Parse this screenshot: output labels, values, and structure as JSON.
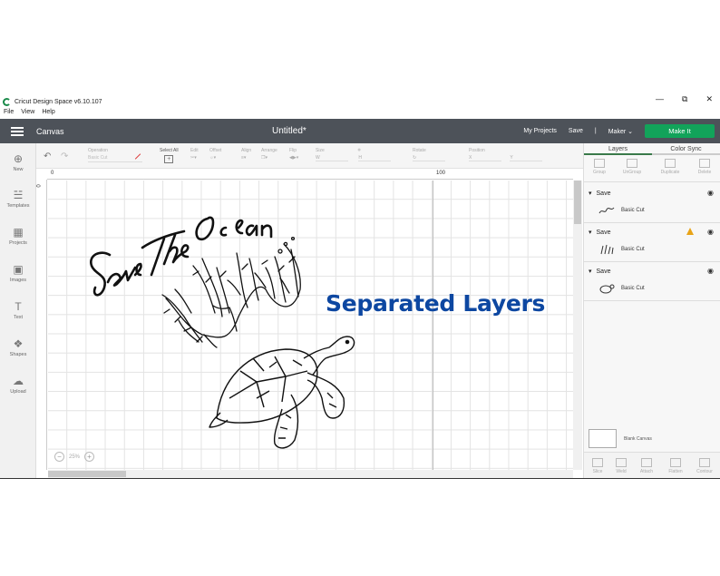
{
  "window": {
    "title": "Cricut Design Space  v6.10.107",
    "minimize": "—",
    "maximize": "⧉",
    "close": "✕"
  },
  "menu": [
    "File",
    "View",
    "Help"
  ],
  "header": {
    "canvas_label": "Canvas",
    "doc_title": "Untitled*",
    "my_projects": "My Projects",
    "save": "Save",
    "divider": "|",
    "machine": "Maker",
    "make_it": "Make It"
  },
  "rail": [
    {
      "label": "New",
      "icon": "⊕"
    },
    {
      "label": "Templates",
      "icon": "☱"
    },
    {
      "label": "Projects",
      "icon": "▦"
    },
    {
      "label": "Images",
      "icon": "▣"
    },
    {
      "label": "Text",
      "icon": "T"
    },
    {
      "label": "Shapes",
      "icon": "❖"
    },
    {
      "label": "Upload",
      "icon": "☁"
    }
  ],
  "toolbar": {
    "operation_label": "Operation",
    "operation_value": "Basic Cut",
    "select_all": "Select All",
    "edit": "Edit",
    "offset": "Offset",
    "align": "Align",
    "arrange": "Arrange",
    "flip": "Flip",
    "size": "Size",
    "size_w": "W",
    "size_h": "H",
    "rotate": "Rotate",
    "position": "Position",
    "pos_x": "X",
    "pos_y": "Y"
  },
  "ruler": {
    "top_0": "0",
    "top_100": "100",
    "left_0": "0"
  },
  "zoom": {
    "minus": "−",
    "value": "25%",
    "plus": "+"
  },
  "overlay": {
    "text": "Separated Layers",
    "color": "#0d47a1"
  },
  "design": {
    "script_text": "Save The Ocean"
  },
  "panel": {
    "tabs": [
      "Layers",
      "Color Sync"
    ],
    "actions": [
      "Group",
      "UnGroup",
      "Duplicate",
      "Delete"
    ],
    "layers": [
      {
        "name": "Save",
        "item": "Basic Cut",
        "warning": false
      },
      {
        "name": "Save",
        "item": "Basic Cut",
        "warning": true
      },
      {
        "name": "Save",
        "item": "Basic Cut",
        "warning": false
      }
    ],
    "blank_canvas": "Blank Canvas",
    "bottom_actions": [
      "Slice",
      "Weld",
      "Attach",
      "Flatten",
      "Contour"
    ]
  },
  "colors": {
    "header_bg": "#4d5259",
    "make_it": "#12a35a",
    "accent_text": "#0d47a1"
  }
}
